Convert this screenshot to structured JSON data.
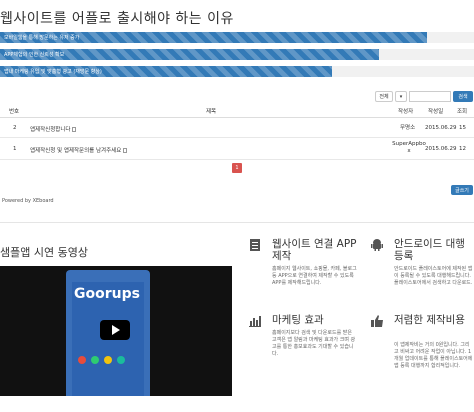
{
  "page_title": "웹사이트를 어플로 출시해야 하는 이유",
  "progress_bars": [
    {
      "label": "모바일웹을 통해 방문하는 유저 증가",
      "value": 0.9
    },
    {
      "label": "APP체험의 인한 신뢰성 확보",
      "value": 0.8
    },
    {
      "label": "앱내 마케팅 유입 및 맞춤형 광고 (재방문 향상)",
      "value": 0.7
    }
  ],
  "toolbar": {
    "filter_label": "전체",
    "dropdown_label": "▾",
    "search_placeholder": "",
    "search_button": "검색"
  },
  "table": {
    "headers": {
      "num": "번호",
      "title": "제목",
      "author": "작성자",
      "date": "작성일",
      "views": "조회"
    },
    "rows": [
      {
        "num": "2",
        "title": "앱제작신청합니다",
        "author": "무명소",
        "date": "2015.06.29",
        "views": "15"
      },
      {
        "num": "1",
        "title": "앱제작신청 및 앱제작문의를 남겨주세요",
        "author": "SuperAppbo\nx",
        "date": "2015.06.29",
        "views": "12"
      }
    ]
  },
  "pagination": {
    "current": "1"
  },
  "write_button": "글쓰기",
  "powered_by": "Powered by XEboard",
  "video": {
    "title": "샘플앱 시연 동영상",
    "brand": "Goorups"
  },
  "features": [
    {
      "icon": "document-icon",
      "title": "웹사이트 연결 APP 제작",
      "desc": "홈페이지 웹사이트, 쇼핑몰, 카페, 블로그 등 APP으로 연결하여 제작할 수 있도록 APP를 제작해드립니다."
    },
    {
      "icon": "android-icon",
      "title": "안드로이드 대행등록",
      "desc": "안드로이드 플레이스토어에 제작된 앱이 등록될 수 있도록 대행해드립니다. 플레이스토어에서 검색하고 다운로드."
    },
    {
      "icon": "bar-chart-icon",
      "title": "마케팅 효과",
      "desc": "홈페이지보다 검색 및 다운로드를 받은 고객은 앱 알림과 마케팅 효과가 크며 광고를 통한 홍보효과도 기대할 수 있습니다."
    },
    {
      "icon": "thumbs-up-icon",
      "title": "저렴한 제작비용",
      "desc": "이 앱제작비는 거의 0원입니다. 그리고 비싸고 어려운 작업이 아닙니다. 1개월 업데이트를 통해 플레이스토어에 앱 등록 대행까지 합리적입니다."
    }
  ],
  "colors": {
    "accent": "#337ab7",
    "pagination": "#d9534f"
  }
}
